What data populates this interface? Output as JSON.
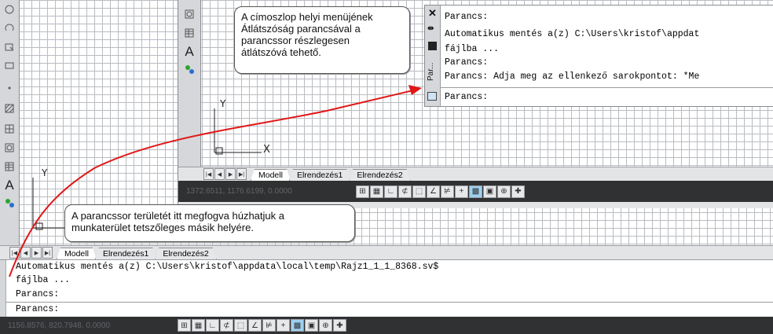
{
  "callout_top": {
    "lines": [
      "A címoszlop helyi menüjének",
      "Átlátszóság parancsával a",
      "parancssor részlegesen",
      "átlátszóvá tehető."
    ]
  },
  "callout_bottom": {
    "lines": [
      "A parancssor területét itt megfogva húzhatjuk a",
      "munkaterület tetszőleges másik helyére."
    ]
  },
  "floating_cmd": {
    "title": "Par...",
    "history": [
      "Parancs:",
      "Automatikus mentés a(z) C:\\Users\\kristof\\appdat",
      "fájlba ...",
      "Parancs:",
      "Parancs: Adja meg az ellenkező sarokpontot: *Me"
    ],
    "prompt": "Parancs:"
  },
  "docked_cmd": {
    "history": [
      "Automatikus mentés a(z) C:\\Users\\kristof\\appdata\\local\\temp\\Rajz1_1_1_8368.sv$",
      "fájlba ...",
      "Parancs:"
    ],
    "prompt": "Parancs:"
  },
  "inner_view": {
    "tabs": [
      "Modell",
      "Elrendezés1",
      "Elrendezés2"
    ],
    "coords": "1372.6511, 1176.6199, 0.0000"
  },
  "outer_view": {
    "tabs": [
      "Modell",
      "Elrendezés1",
      "Elrendezés2"
    ],
    "coords": "1156.8576, 820.7948, 0.0000"
  },
  "axis_labels": {
    "x": "X",
    "y": "Y"
  },
  "palette_text_icon": "A",
  "colors": {
    "arrow": "#e01818",
    "grid": "#b9bcc2",
    "status_bg": "#2f3133",
    "toggle_on": "#9dd0f0"
  }
}
